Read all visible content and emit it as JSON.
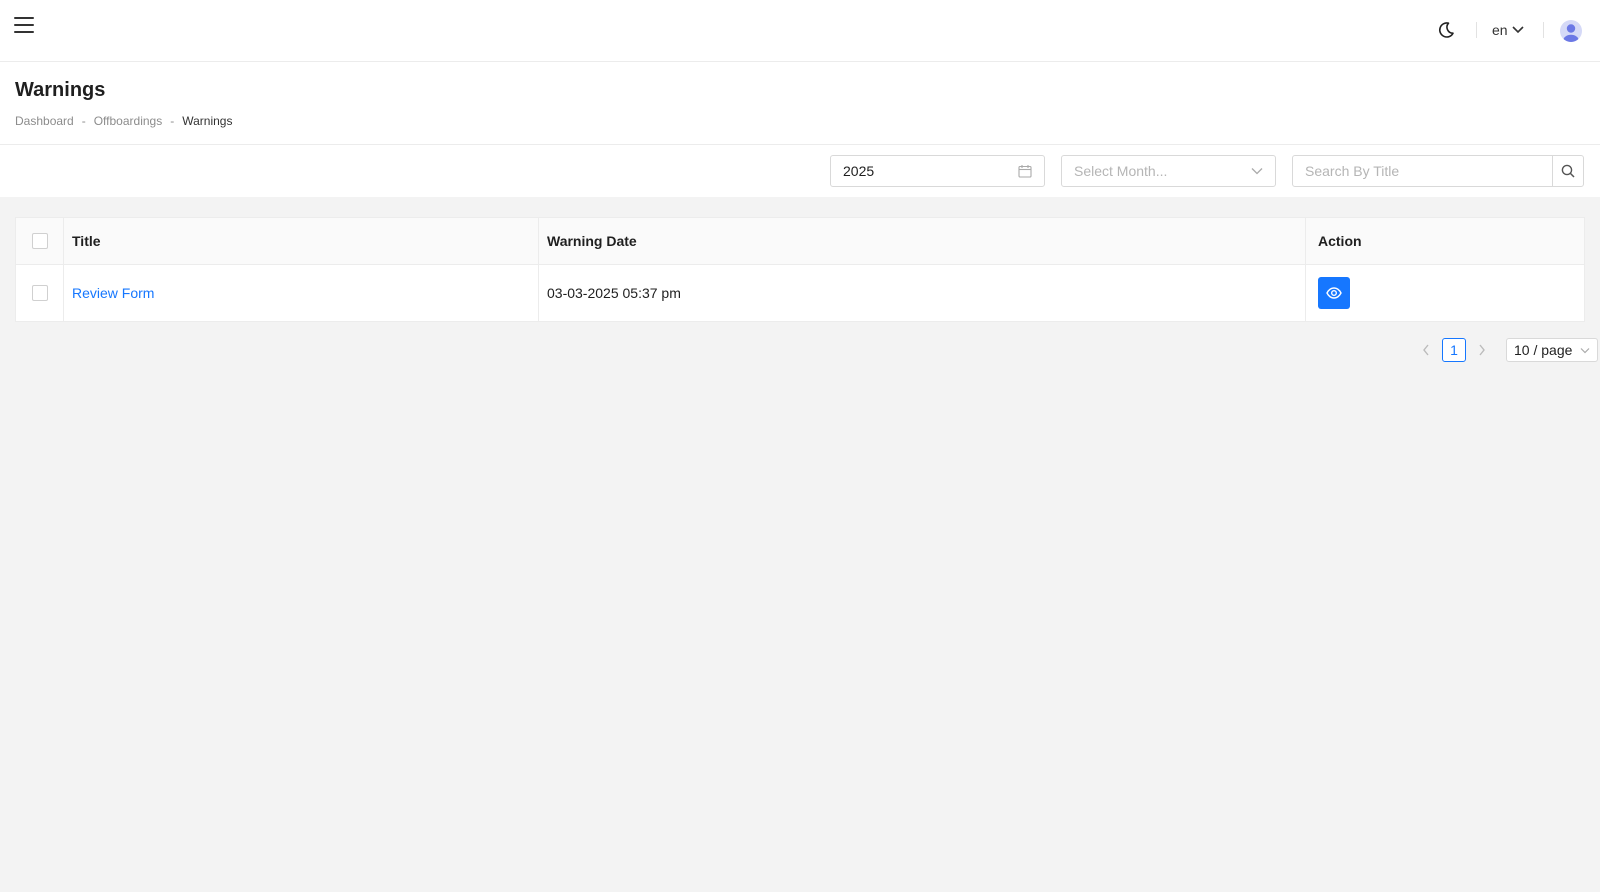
{
  "topbar": {
    "language": "en"
  },
  "page": {
    "title": "Warnings",
    "breadcrumb": {
      "items": [
        "Dashboard",
        "Offboardings"
      ],
      "separator": "-",
      "current": "Warnings"
    }
  },
  "filters": {
    "year_value": "2025",
    "month_placeholder": "Select Month...",
    "search_placeholder": "Search By Title"
  },
  "table": {
    "columns": [
      "Title",
      "Warning Date",
      "Action"
    ],
    "rows": [
      {
        "title": "Review Form",
        "warning_date": "03-03-2025 05:37 pm"
      }
    ]
  },
  "pagination": {
    "current_page": "1",
    "page_size": "10 / page"
  },
  "colors": {
    "accent": "#1677ff"
  }
}
